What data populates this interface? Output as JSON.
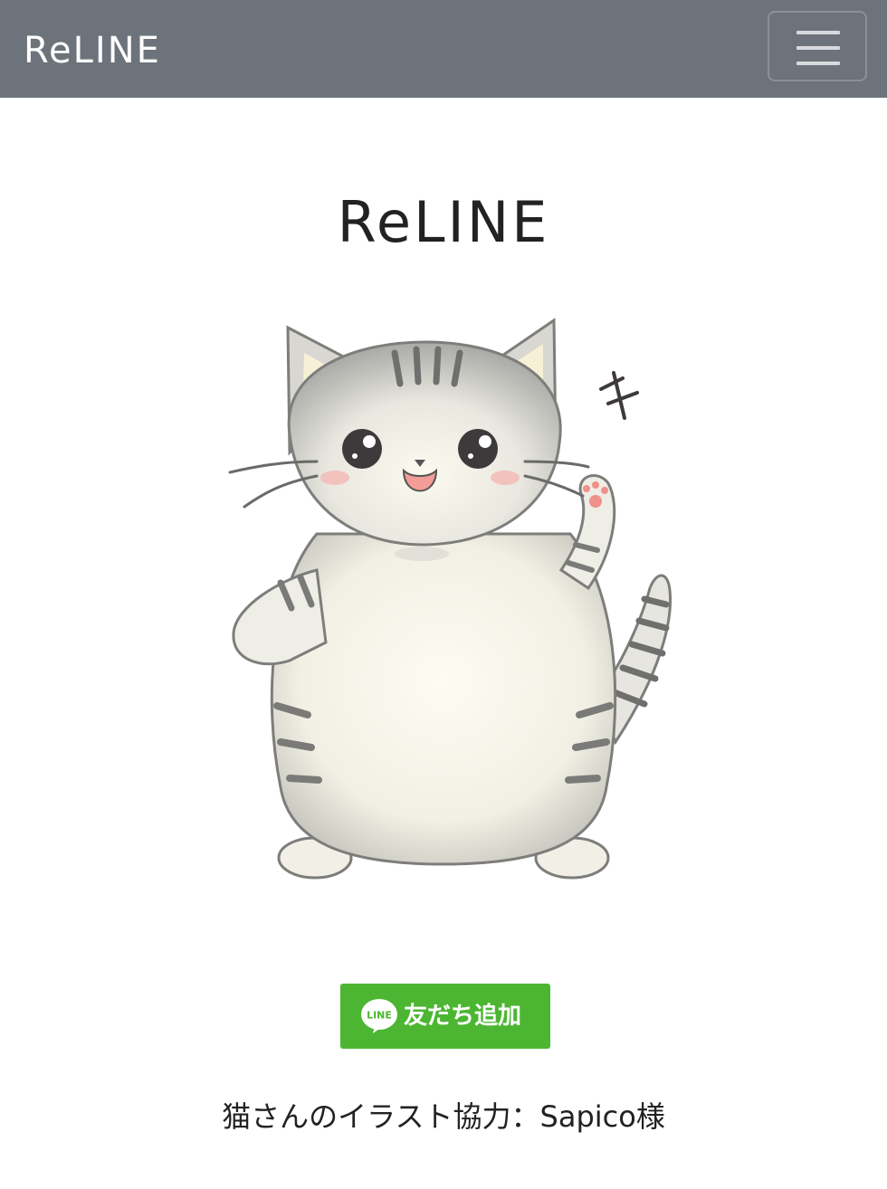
{
  "navbar": {
    "brand": "ReLINE",
    "toggler_icon": "hamburger-icon",
    "background": "#6c737b"
  },
  "main": {
    "title": "ReLINE",
    "illustration": "cat-illustration",
    "add_friend_button": {
      "logo_text": "LINE",
      "label": "友だち追加",
      "color": "#4cb632"
    },
    "credit": "猫さんのイラスト協力：Sapico様"
  }
}
